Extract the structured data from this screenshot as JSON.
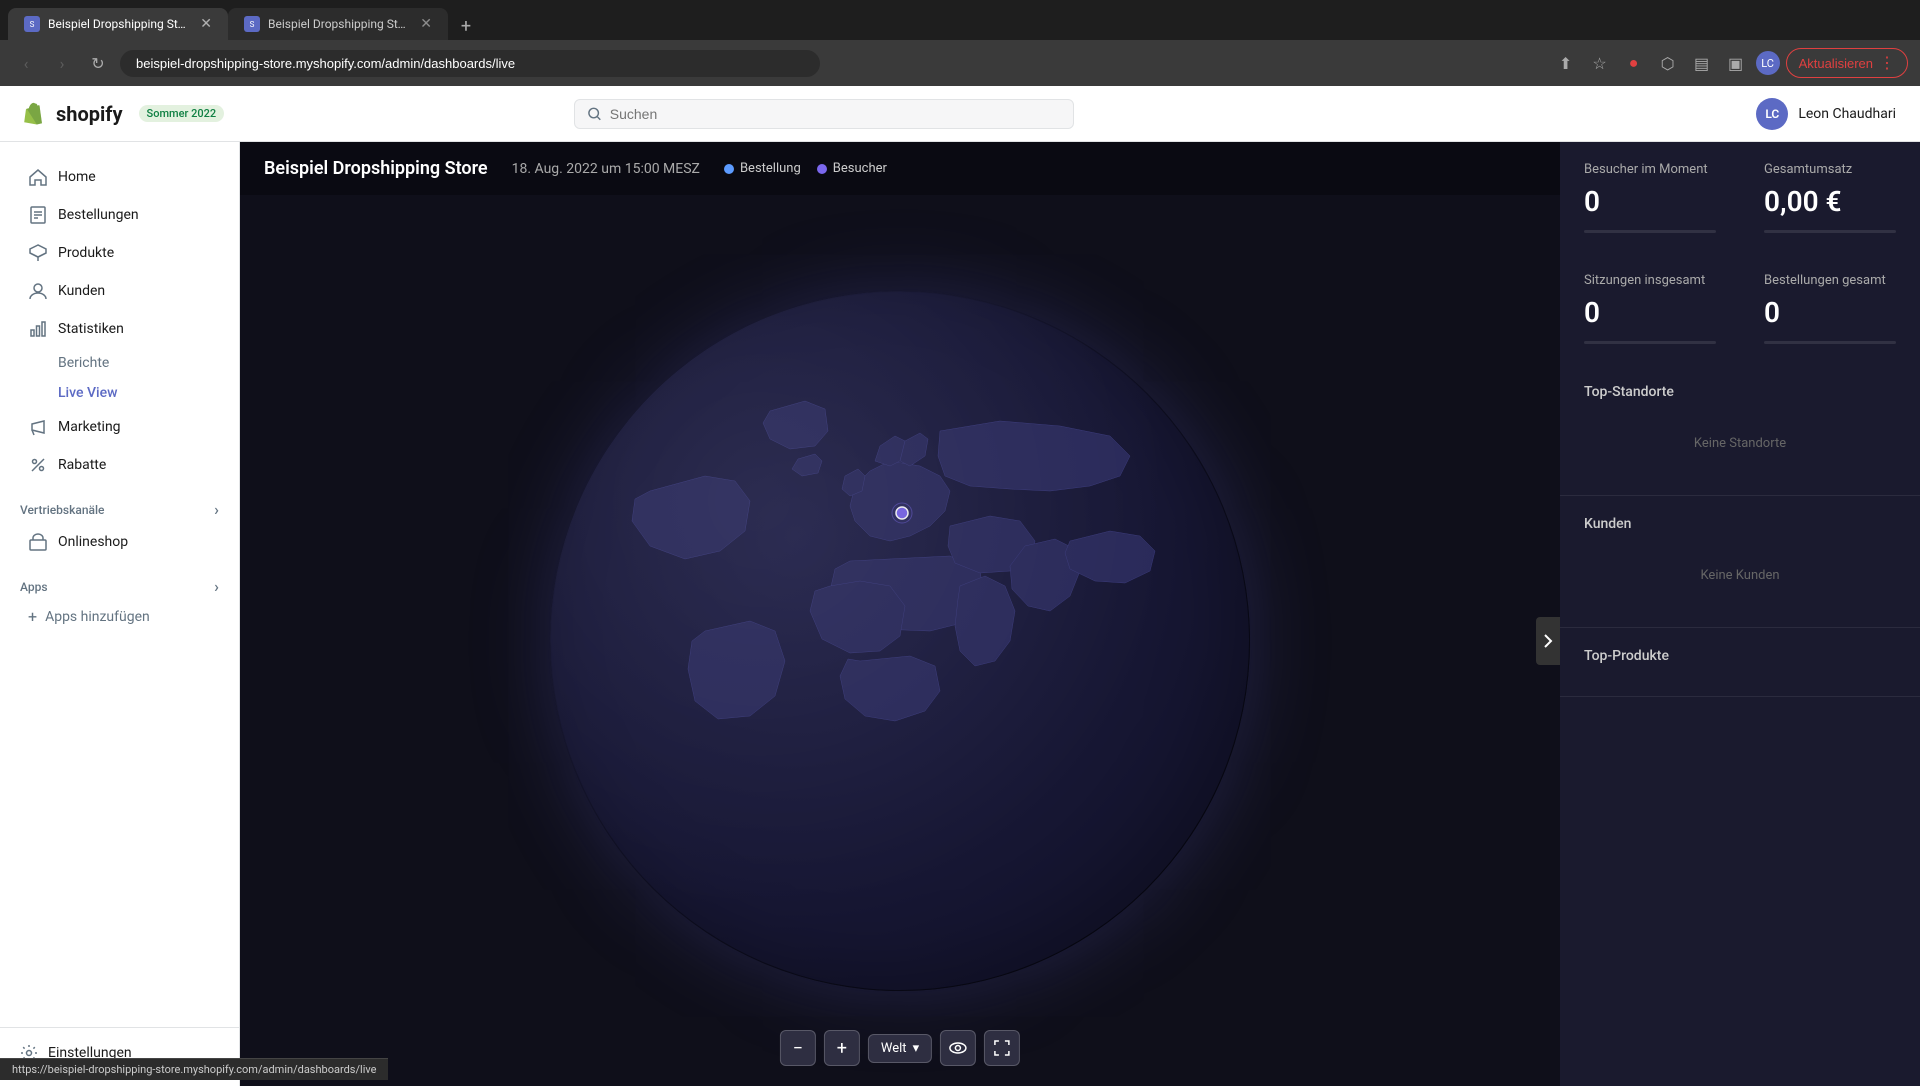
{
  "browser": {
    "tabs": [
      {
        "id": "tab1",
        "title": "Beispiel Dropshipping Store ·  ...",
        "active": true,
        "favicon": "S"
      },
      {
        "id": "tab2",
        "title": "Beispiel Dropshipping Store",
        "active": false,
        "favicon": "S"
      }
    ],
    "url": "beispiel-dropshipping-store.myshopify.com/admin/dashboards/live",
    "update_button": "Aktualisieren"
  },
  "header": {
    "logo_text": "shopify",
    "badge": "Sommer 2022",
    "search_placeholder": "Suchen",
    "user_initials": "LC",
    "user_name": "Leon Chaudhari"
  },
  "sidebar": {
    "nav_items": [
      {
        "id": "home",
        "label": "Home",
        "icon": "home"
      },
      {
        "id": "orders",
        "label": "Bestellungen",
        "icon": "orders"
      },
      {
        "id": "products",
        "label": "Produkte",
        "icon": "products"
      },
      {
        "id": "customers",
        "label": "Kunden",
        "icon": "customers"
      },
      {
        "id": "statistics",
        "label": "Statistiken",
        "icon": "statistics",
        "expanded": true
      }
    ],
    "sub_items": [
      {
        "id": "reports",
        "label": "Berichte",
        "active": false
      },
      {
        "id": "liveview",
        "label": "Live View",
        "active": true
      }
    ],
    "nav_items2": [
      {
        "id": "marketing",
        "label": "Marketing",
        "icon": "marketing"
      },
      {
        "id": "discounts",
        "label": "Rabatte",
        "icon": "discounts"
      }
    ],
    "sales_channels_label": "Vertriebskanäle",
    "sales_channels": [
      {
        "id": "onlineshop",
        "label": "Onlineshop",
        "icon": "shop"
      }
    ],
    "apps_label": "Apps",
    "add_apps_label": "Apps hinzufügen",
    "settings_label": "Einstellungen"
  },
  "map": {
    "store_name": "Beispiel Dropshipping Store",
    "date": "18. Aug. 2022 um 15:00 MESZ",
    "legend": [
      {
        "label": "Bestellung",
        "color": "#5c9bff"
      },
      {
        "label": "Besucher",
        "color": "#7b68ee"
      }
    ],
    "zoom_minus": "−",
    "zoom_plus": "+",
    "region_label": "Welt",
    "eye_icon": "eye",
    "fullscreen_icon": "fullscreen"
  },
  "stats": {
    "visitors_label": "Besucher im Moment",
    "visitors_value": "0",
    "revenue_label": "Gesamtumsatz",
    "revenue_value": "0,00 €",
    "sessions_label": "Sitzungen insgesamt",
    "sessions_value": "0",
    "orders_label": "Bestellungen gesamt",
    "orders_value": "0",
    "top_locations_label": "Top-Standorte",
    "no_locations_text": "Keine Standorte",
    "customers_label": "Kunden",
    "no_customers_text": "Keine Kunden",
    "top_products_label": "Top-Produkte"
  },
  "statusbar": {
    "url": "https://beispiel-dropshipping-store.myshopify.com/admin/dashboards/live"
  }
}
